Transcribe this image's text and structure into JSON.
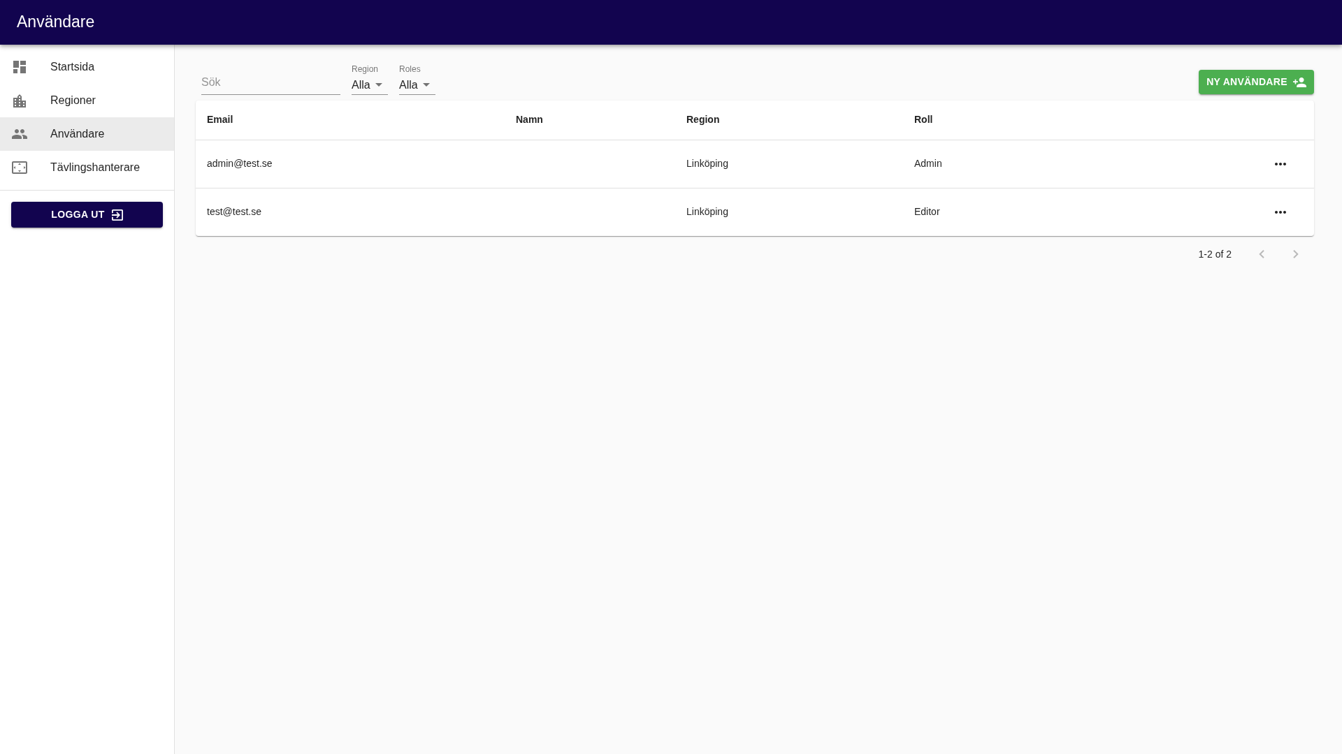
{
  "app_bar": {
    "title": "Användare"
  },
  "sidebar": {
    "items": [
      {
        "label": "Startsida",
        "selected": false
      },
      {
        "label": "Regioner",
        "selected": false
      },
      {
        "label": "Användare",
        "selected": true
      },
      {
        "label": "Tävlingshanterare",
        "selected": false
      }
    ],
    "logout_button": {
      "label": "LOGGA UT"
    }
  },
  "toolbar": {
    "search": {
      "placeholder": "Sök"
    },
    "filters": [
      {
        "label": "Region",
        "value": "Alla"
      },
      {
        "label": "Roles",
        "value": "Alla"
      }
    ],
    "new_user_button": {
      "label": "NY ANVÄNDARE"
    }
  },
  "table": {
    "columns": [
      "Email",
      "Namn",
      "Region",
      "Roll"
    ],
    "rows": [
      {
        "email": "admin@test.se",
        "region": "Linköping",
        "role": "Admin"
      },
      {
        "email": "test@test.se",
        "region": "Linköping",
        "role": "Editor"
      }
    ]
  },
  "pagination": {
    "range": "1-2 of 2",
    "previous": {
      "disabled": true
    },
    "next": {
      "disabled": true
    }
  }
}
